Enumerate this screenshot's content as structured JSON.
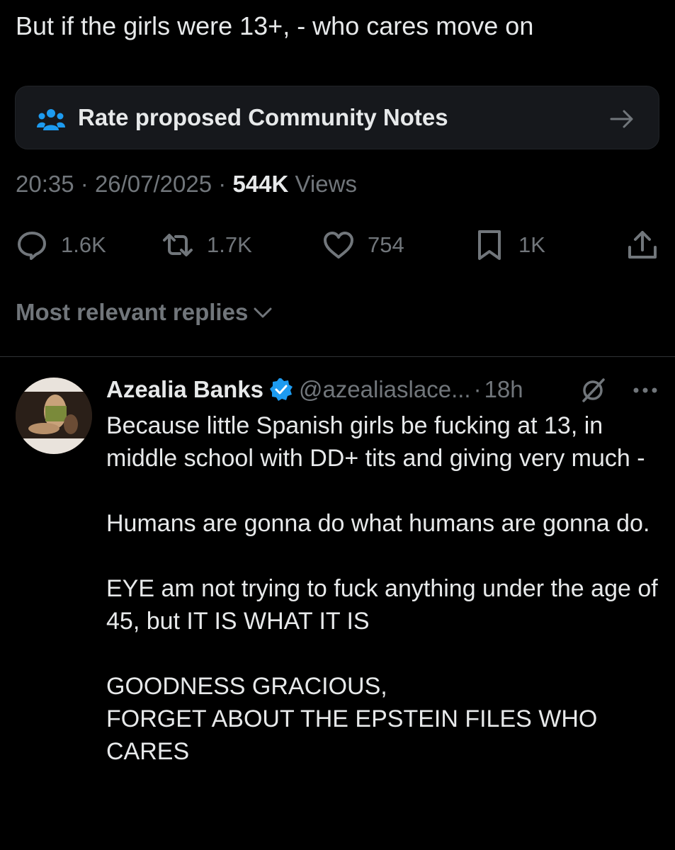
{
  "tweet": {
    "text": "But if the girls were 13+, - who cares move on",
    "time": "20:35",
    "date": "26/07/2025",
    "views_count": "544K",
    "views_label": "Views"
  },
  "community_notes": {
    "label": "Rate proposed Community Notes",
    "icon": "community-notes-icon"
  },
  "actions": {
    "replies": "1.6K",
    "reposts": "1.7K",
    "likes": "754",
    "bookmarks": "1K"
  },
  "sort": {
    "label": "Most relevant replies"
  },
  "reply": {
    "name": "Azealia Banks",
    "handle": "@azealiaslace...",
    "time": "18h",
    "paragraphs": [
      "Because little Spanish girls be fucking at 13, in middle school with DD+ tits and giving very much -",
      "Humans are gonna do what humans are gonna do.",
      "EYE am not trying to fuck anything under the age of 45, but IT IS WHAT IT IS",
      "GOODNESS GRACIOUS,",
      "FORGET ABOUT THE EPSTEIN FILES WHO CARES"
    ]
  },
  "colors": {
    "background": "#000000",
    "text": "#e7e9ea",
    "muted": "#71767b",
    "card": "#16181c",
    "accent": "#1d9bf0"
  }
}
